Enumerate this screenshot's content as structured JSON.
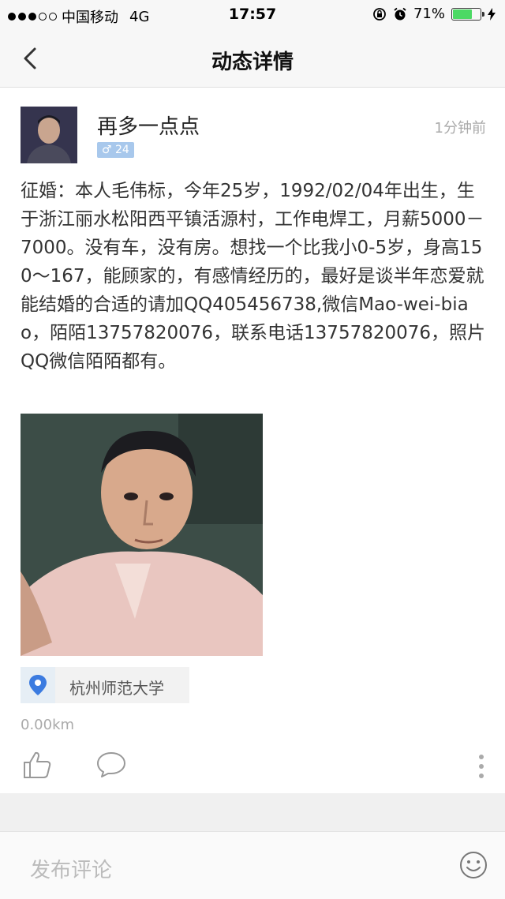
{
  "status_bar": {
    "carrier": "中国移动",
    "network": "4G",
    "time": "17:57",
    "battery": "71%",
    "battery_level": 0.71
  },
  "nav": {
    "title": "动态详情"
  },
  "post": {
    "username": "再多一点点",
    "gender_age": "♂ 24",
    "time": "1分钟前",
    "content": "征婚：本人毛伟标，今年25岁，1992/02/04年出生，生于浙江丽水松阳西平镇活源村，工作电焊工，月薪5000－7000。没有车，没有房。想找一个比我小0-5岁，身高150～167，能顾家的，有感情经历的，最好是谈半年恋爱就能结婚的合适的请加QQ405456738,微信Mao-wei-biao，陌陌13757820076，联系电话13757820076，照片QQ微信陌陌都有。",
    "location": "杭州师范大学",
    "distance": "0.00km"
  },
  "comment_bar": {
    "placeholder": "发布评论"
  },
  "colors": {
    "badge": "#a8c8ec",
    "location_pin": "#3b7be0",
    "battery": "#4cd964"
  }
}
